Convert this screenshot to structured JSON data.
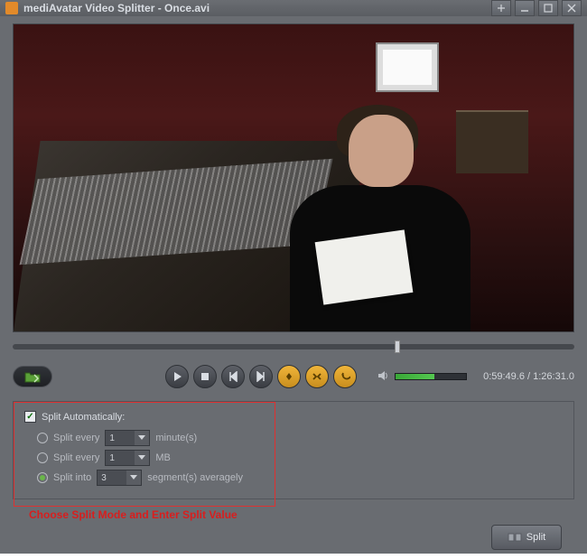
{
  "window": {
    "title": "mediAvatar Video Splitter  - Once.avi"
  },
  "playback": {
    "current_time": "0:59:49.6",
    "total_time": "1:26:31.0",
    "time_display": "0:59:49.6 / 1:26:31.0",
    "progress_percent": 68,
    "volume_percent": 55
  },
  "options": {
    "auto_label": "Split Automatically:",
    "auto_checked": true,
    "row1": {
      "label_pre": "Split every",
      "value": "1",
      "label_post": "minute(s)",
      "selected": false
    },
    "row2": {
      "label_pre": "Split every",
      "value": "1",
      "label_post": "MB",
      "selected": false
    },
    "row3": {
      "label_pre": "Split into",
      "value": "3",
      "label_post": "segment(s) averagely",
      "selected": true
    }
  },
  "annotation": "Choose Split Mode and Enter Split Value",
  "buttons": {
    "split": "Split"
  },
  "icons": {
    "checkmark": "✓"
  }
}
